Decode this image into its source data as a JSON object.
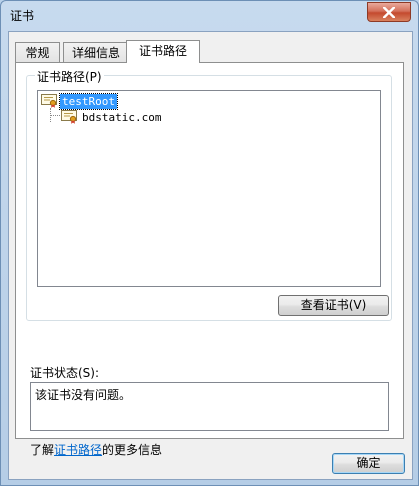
{
  "window": {
    "title": "证书"
  },
  "tabs": [
    {
      "label": "常规"
    },
    {
      "label": "详细信息"
    },
    {
      "label": "证书路径"
    }
  ],
  "cert_path": {
    "group_label": "证书路径(P)",
    "nodes": [
      {
        "label": "testRoot",
        "selected": true
      },
      {
        "label": "bdstatic.com",
        "selected": false
      }
    ],
    "view_button": "查看证书(V)"
  },
  "status": {
    "label": "证书状态(S):",
    "text": "该证书没有问题。"
  },
  "learn_more": {
    "prefix": "了解",
    "link": "证书路径",
    "suffix": "的更多信息"
  },
  "footer": {
    "ok_label": "确定"
  }
}
